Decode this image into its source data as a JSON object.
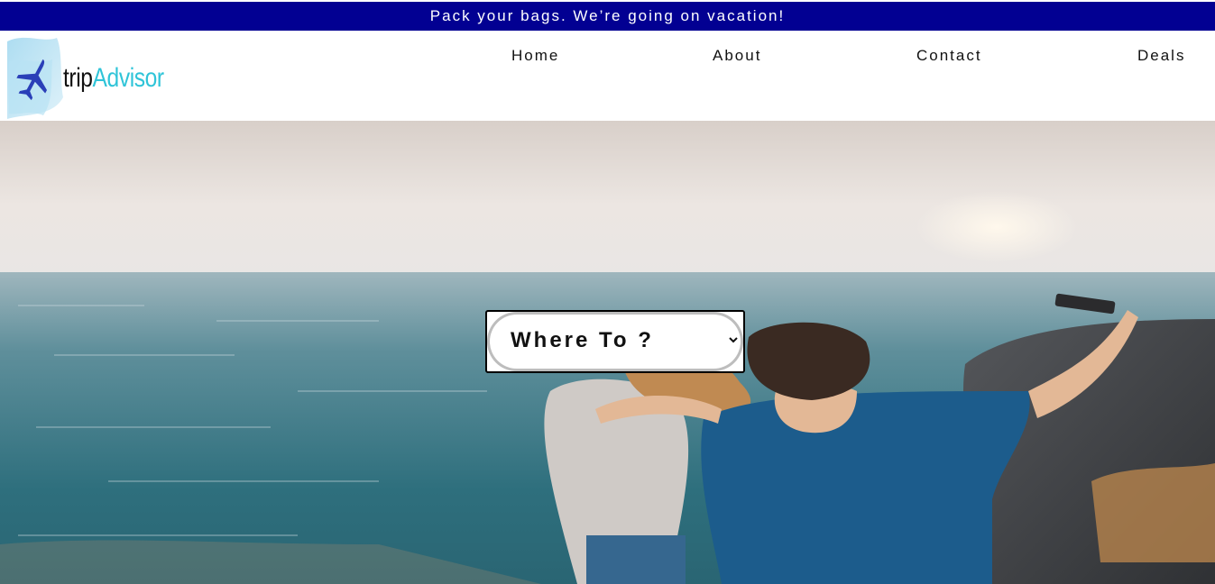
{
  "banner": {
    "text": "Pack your bags. We’re going on vacation!"
  },
  "logo": {
    "trip": "trip",
    "advisor": "Advisor",
    "icon": "airplane-icon"
  },
  "nav": [
    {
      "label": "Home"
    },
    {
      "label": "About"
    },
    {
      "label": "Contact"
    },
    {
      "label": "Deals"
    }
  ],
  "search": {
    "selected": "Where To ?"
  },
  "colors": {
    "banner_bg": "#020092",
    "brand_accent": "#2fc4d8",
    "plane": "#2a3fb8"
  }
}
